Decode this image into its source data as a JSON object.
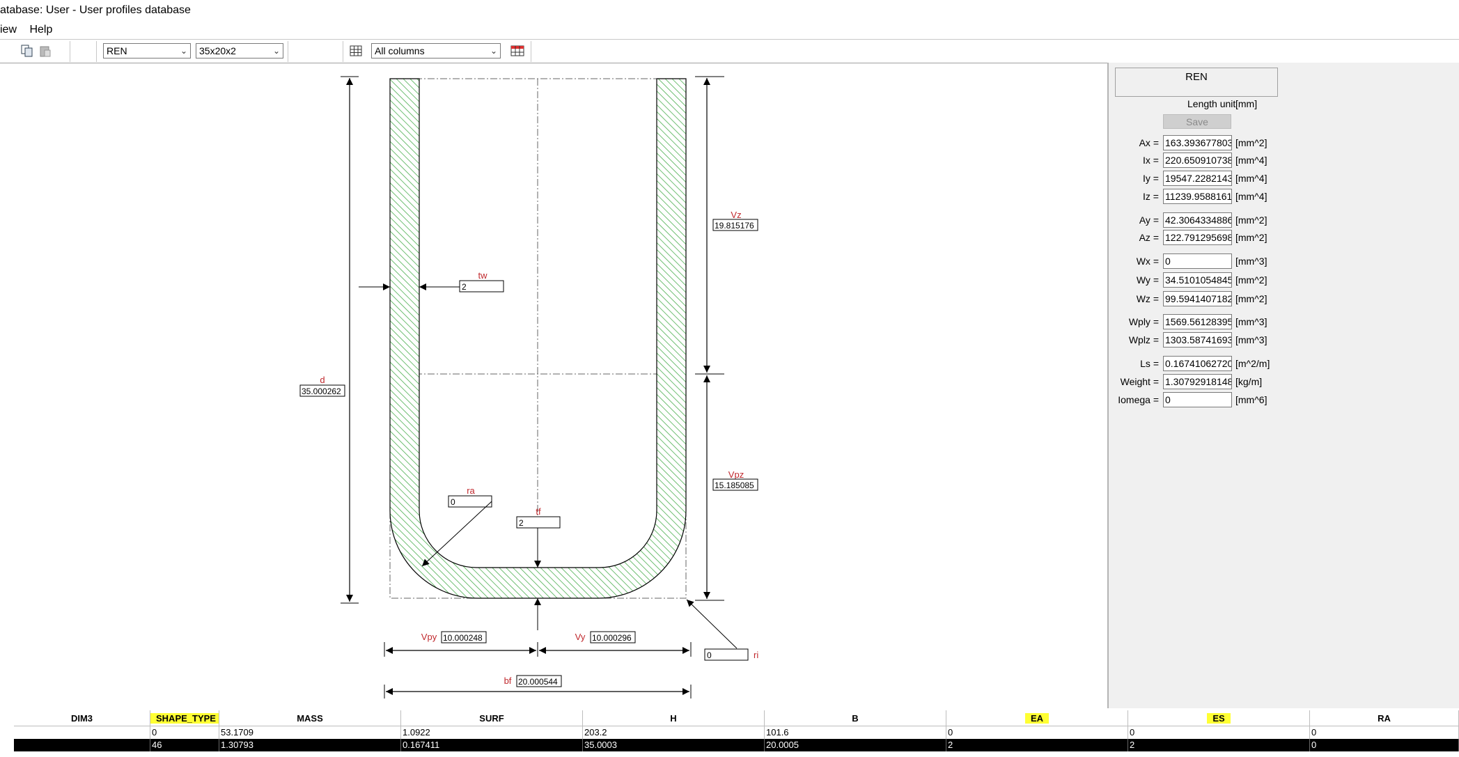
{
  "window": {
    "title": "atabase: User - User profiles database"
  },
  "menu": {
    "items": [
      "iew",
      "Help"
    ]
  },
  "toolbar": {
    "profile_type": "REN",
    "profile_size": "35x20x2",
    "columns": "All columns"
  },
  "drawing": {
    "labels": {
      "d": "d",
      "d_value": "35.000262",
      "tw": "tw",
      "tw_value": "2",
      "vz": "Vz",
      "vz_value": "19.815176",
      "vpz": "Vpz",
      "vpz_value": "15.185085",
      "ra": "ra",
      "ra_value": "0",
      "tf": "tf",
      "tf_value": "2",
      "vpy": "Vpy",
      "vpy_value": "10.000248",
      "vy": "Vy",
      "vy_value": "10.000296",
      "ri": "ri",
      "ri_value": "0",
      "bf": "bf",
      "bf_value": "20.000544"
    },
    "colors": {
      "hatch": "#4caf50",
      "label": "#c0282d"
    }
  },
  "panel": {
    "section_name": "REN",
    "length_unit_label": "Length unit",
    "length_unit": "[mm]",
    "save_label": "Save",
    "properties": [
      {
        "label": "Ax =",
        "value": "163.3936778038",
        "unit": "[mm^2]"
      },
      {
        "label": "Ix =",
        "value": "220.6509107386",
        "unit": "[mm^4]"
      },
      {
        "label": "Iy =",
        "value": "19547.22821432",
        "unit": "[mm^4]"
      },
      {
        "label": "Iz =",
        "value": "11239.95881615",
        "unit": "[mm^4]"
      },
      {
        "label": "Ay =",
        "value": "42.30643348865",
        "unit": "[mm^2]"
      },
      {
        "label": "Az =",
        "value": "122.7912956987",
        "unit": "[mm^2]"
      },
      {
        "label": "Wx =",
        "value": "0",
        "unit": "[mm^3]"
      },
      {
        "label": "Wy =",
        "value": "34.51010548451",
        "unit": "[mm^2]"
      },
      {
        "label": "Wz =",
        "value": "99.59414071822",
        "unit": "[mm^2]"
      },
      {
        "label": "Wply =",
        "value": "1569.561283952",
        "unit": "[mm^3]"
      },
      {
        "label": "Wplz =",
        "value": "1303.587416939",
        "unit": "[mm^3]"
      },
      {
        "label": "Ls =",
        "value": "0.167410627207",
        "unit": "[m^2/m]"
      },
      {
        "label": "Weight =",
        "value": "1.307929181484",
        "unit": "[kg/m]"
      },
      {
        "label": "Iomega =",
        "value": "0",
        "unit": "[mm^6]"
      }
    ]
  },
  "grid": {
    "columns": [
      "DIM3",
      "SHAPE_TYPE",
      "MASS",
      "SURF",
      "H",
      "B",
      "EA",
      "ES",
      "RA"
    ],
    "highlighted_columns": [
      "SHAPE_TYPE",
      "EA",
      "ES"
    ],
    "rows": [
      [
        "",
        "0",
        "53.1709",
        "1.0922",
        "203.2",
        "101.6",
        "0",
        "0",
        "0"
      ],
      [
        "",
        "46",
        "1.30793",
        "0.167411",
        "35.0003",
        "20.0005",
        "2",
        "2",
        "0"
      ]
    ],
    "selected_row": 1
  }
}
